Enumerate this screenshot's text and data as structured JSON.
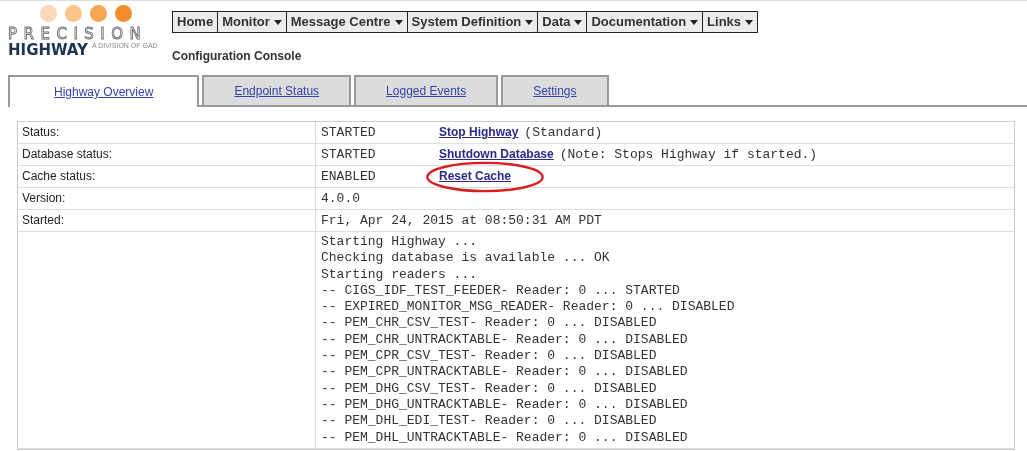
{
  "logo": {
    "wordmark": "PRECISION",
    "tagline": "A DIVISION OF GAD",
    "product": "HIGHWAY"
  },
  "menu": [
    {
      "label": "Home",
      "has_dropdown": false
    },
    {
      "label": "Monitor",
      "has_dropdown": true
    },
    {
      "label": "Message Centre",
      "has_dropdown": true
    },
    {
      "label": "System Definition",
      "has_dropdown": true
    },
    {
      "label": "Data",
      "has_dropdown": true
    },
    {
      "label": "Documentation",
      "has_dropdown": true
    },
    {
      "label": "Links",
      "has_dropdown": true
    }
  ],
  "subtitle": "Configuration Console",
  "tabs": [
    {
      "label": "Highway Overview",
      "selected": true
    },
    {
      "label": "Endpoint Status",
      "selected": false
    },
    {
      "label": "Logged Events",
      "selected": false
    },
    {
      "label": "Settings",
      "selected": false
    }
  ],
  "rows": [
    {
      "label": "Status:",
      "value": "STARTED",
      "link": "Stop Highway",
      "note": "(Standard)",
      "circled": false
    },
    {
      "label": "Database status:",
      "value": "STARTED",
      "link": "Shutdown Database",
      "note": "(Note: Stops Highway if started.)",
      "circled": false
    },
    {
      "label": "Cache status:",
      "value": "ENABLED",
      "link": "Reset Cache",
      "circled": true
    },
    {
      "label": "Version:",
      "value": "4.0.0"
    },
    {
      "label": "Started:",
      "value": "Fri, Apr 24, 2015 at 08:50:31 AM PDT"
    }
  ],
  "log_lines": [
    "Starting Highway ...",
    "Checking database is available ... OK",
    "Starting readers ...",
    "-- CIGS_IDF_TEST_FEEDER- Reader: 0 ... STARTED",
    "-- EXPIRED_MONITOR_MSG_READER- Reader: 0 ... DISABLED",
    "-- PEM_CHR_CSV_TEST- Reader: 0 ... DISABLED",
    "-- PEM_CHR_UNTRACKTABLE- Reader: 0 ... DISABLED",
    "-- PEM_CPR_CSV_TEST- Reader: 0 ... DISABLED",
    "-- PEM_CPR_UNTRACKTABLE- Reader: 0 ... DISABLED",
    "-- PEM_DHG_CSV_TEST- Reader: 0 ... DISABLED",
    "-- PEM_DHG_UNTRACKTABLE- Reader: 0 ... DISABLED",
    "-- PEM_DHL_EDI_TEST- Reader: 0 ... DISABLED",
    "-- PEM_DHL_UNTRACKTABLE- Reader: 0 ... DISABLED"
  ]
}
